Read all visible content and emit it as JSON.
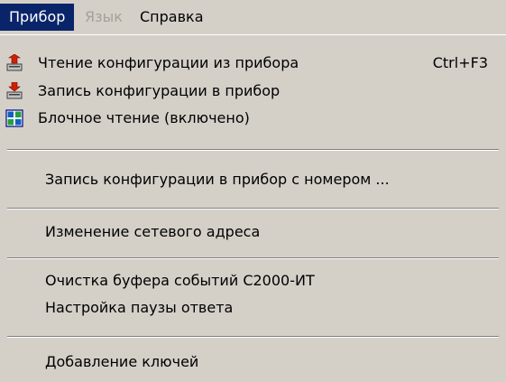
{
  "menubar": {
    "items": [
      {
        "label": "Прибор",
        "state": "active"
      },
      {
        "label": "Язык",
        "state": "disabled"
      },
      {
        "label": "Справка",
        "state": "normal"
      }
    ]
  },
  "menu": {
    "items": [
      {
        "label": "Чтение конфигурации из прибора",
        "shortcut": "Ctrl+F3",
        "icon": "read-from-device-icon"
      },
      {
        "label": "Запись конфигурации в прибор",
        "icon": "write-to-device-icon"
      },
      {
        "label": "Блочное чтение (включено)",
        "icon": "block-grid-icon"
      },
      {
        "label": "Запись конфигурации в прибор с номером ..."
      },
      {
        "label": "Изменение сетевого адреса"
      },
      {
        "label": "Очистка буфера событий С2000-ИТ"
      },
      {
        "label": "Настройка паузы ответа"
      },
      {
        "label": "Добавление ключей"
      }
    ]
  },
  "colors": {
    "menu_bg": "#d4d0c8",
    "highlight": "#0a246a",
    "disabled_text": "#a4a09b"
  }
}
